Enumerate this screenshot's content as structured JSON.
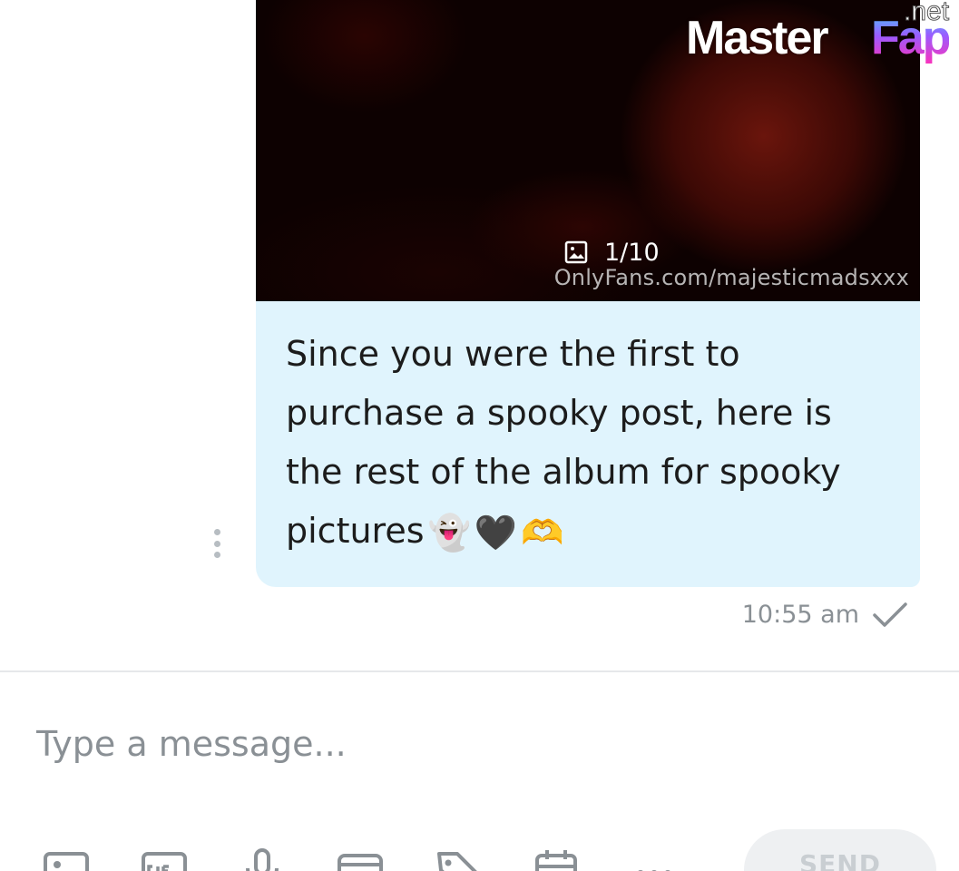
{
  "brand": {
    "master": "Master",
    "fap": "Fap",
    "net": ".net"
  },
  "media": {
    "counter": "1/10",
    "watermark": "OnlyFans.com/majesticmadsxxx"
  },
  "message": {
    "text": "Since you were the first to purchase a spooky post, here is the rest of the album for spooky pictures",
    "emojis": [
      "👻",
      "🖤",
      "🫶"
    ],
    "time": "10:55 am",
    "status_icon": "check-icon"
  },
  "composer": {
    "placeholder": "Type a message...",
    "send_label": "SEND",
    "tools": [
      "image-icon",
      "gif-icon",
      "microphone-icon",
      "vault-icon",
      "price-tag-icon",
      "calendar-icon",
      "more-icon"
    ]
  },
  "colors": {
    "bubble": "#e0f4fd",
    "meta_gray": "#8a9095",
    "icon_gray": "#8a9095"
  }
}
